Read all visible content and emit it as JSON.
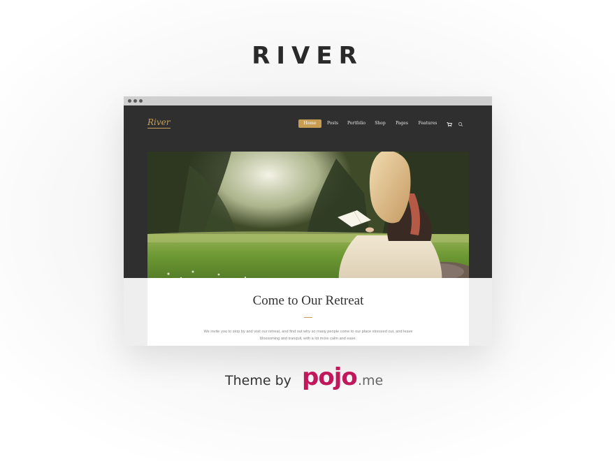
{
  "page": {
    "title": "RIVER"
  },
  "browser": {
    "dots": [
      "dot",
      "dot",
      "dot"
    ]
  },
  "site": {
    "logo": "River",
    "nav": [
      {
        "label": "Home",
        "active": true
      },
      {
        "label": "Posts",
        "active": false
      },
      {
        "label": "Portfolio",
        "active": false
      },
      {
        "label": "Shop",
        "active": false
      },
      {
        "label": "Pages",
        "active": false
      },
      {
        "label": "Features",
        "active": false
      }
    ],
    "icons": {
      "cart": "cart-icon",
      "search": "search-icon"
    }
  },
  "content": {
    "heading": "Come to Our Retreat",
    "body": "We invite you to stop by and visit our retreat, and find out why so many people  come to our place stressed out, and leave blossoming and tranquil, with a lot more calm and ease."
  },
  "credit": {
    "prefix": "Theme by",
    "brand": "pojo",
    "suffix": ".me"
  },
  "colors": {
    "accent": "#c79c53",
    "brand": "#c0185a",
    "header_bg": "#2f2f2f"
  }
}
